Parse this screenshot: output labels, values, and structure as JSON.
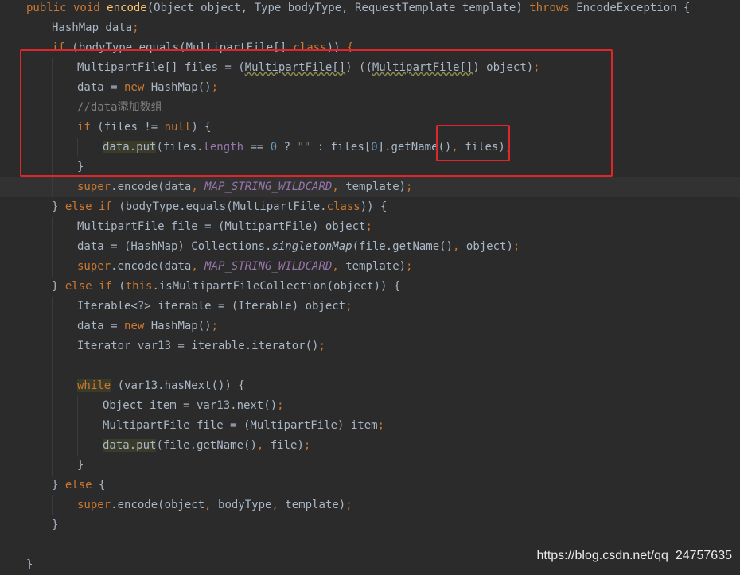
{
  "editor": {
    "lines": [
      {
        "tokens": [
          [
            "kw",
            "public void "
          ],
          [
            "fn",
            "encode"
          ],
          [
            "",
            "(Object object, Type bodyType, RequestTemplate template) "
          ],
          [
            "kw",
            "throws "
          ],
          [
            "",
            "EncodeException {"
          ]
        ]
      },
      {
        "tokens": [
          [
            "",
            "HashMap data"
          ],
          [
            "kw",
            ";"
          ]
        ]
      },
      {
        "tokens": [
          [
            "kw",
            "if "
          ],
          [
            "",
            "(bodyType.equals(MultipartFile[]."
          ],
          [
            "kw",
            "class"
          ],
          [
            "",
            "))"
          ],
          [
            "kw",
            " {"
          ]
        ]
      },
      {
        "tokens": [
          [
            "",
            "MultipartFile[] files = ("
          ],
          [
            "warn",
            "MultipartFile[]"
          ],
          [
            "",
            ") (("
          ],
          [
            "warn",
            "MultipartFile[]"
          ],
          [
            "",
            ") object)"
          ],
          [
            "kw",
            ";"
          ]
        ]
      },
      {
        "tokens": [
          [
            "",
            "data = "
          ],
          [
            "kw",
            "new "
          ],
          [
            "",
            "HashMap()"
          ],
          [
            "kw",
            ";"
          ]
        ]
      },
      {
        "tokens": [
          [
            "cmt",
            "//data添加数组"
          ]
        ]
      },
      {
        "tokens": [
          [
            "kw",
            "if "
          ],
          [
            "",
            "(files != "
          ],
          [
            "kw",
            "null"
          ],
          [
            "",
            ") {"
          ]
        ]
      },
      {
        "tokens": [
          [
            "hl",
            "data.put"
          ],
          [
            "",
            "(files."
          ],
          [
            "field",
            "length"
          ],
          [
            "",
            " == "
          ],
          [
            "num",
            "0"
          ],
          [
            "",
            " ? "
          ],
          [
            "str",
            "\"\""
          ],
          [
            "",
            " : files["
          ],
          [
            "num",
            "0"
          ],
          [
            "",
            "].getName()"
          ],
          [
            "kw",
            ", "
          ],
          [
            "",
            "files)"
          ],
          [
            "kw",
            ";"
          ]
        ]
      },
      {
        "tokens": [
          [
            "",
            "}"
          ]
        ]
      },
      {
        "tokens": [
          [
            "kw",
            "super"
          ],
          [
            "",
            ".encode(data"
          ],
          [
            "kw",
            ", "
          ],
          [
            "const",
            "MAP_STRING_WILDCARD"
          ],
          [
            "kw",
            ", "
          ],
          [
            "",
            "template)"
          ],
          [
            "kw",
            ";"
          ]
        ]
      },
      {
        "tokens": [
          [
            "",
            "} "
          ],
          [
            "kw",
            "else if "
          ],
          [
            "",
            "(bodyType.equals(MultipartFile."
          ],
          [
            "kw",
            "class"
          ],
          [
            "",
            ")) {"
          ]
        ]
      },
      {
        "tokens": [
          [
            "",
            "MultipartFile file = (MultipartFile) object"
          ],
          [
            "kw",
            ";"
          ]
        ]
      },
      {
        "tokens": [
          [
            "",
            "data = (HashMap) Collections."
          ],
          [
            "it",
            "singletonMap"
          ],
          [
            "",
            "(file.getName()"
          ],
          [
            "kw",
            ", "
          ],
          [
            "",
            "object)"
          ],
          [
            "kw",
            ";"
          ]
        ]
      },
      {
        "tokens": [
          [
            "kw",
            "super"
          ],
          [
            "",
            ".encode(data"
          ],
          [
            "kw",
            ", "
          ],
          [
            "const",
            "MAP_STRING_WILDCARD"
          ],
          [
            "kw",
            ", "
          ],
          [
            "",
            "template)"
          ],
          [
            "kw",
            ";"
          ]
        ]
      },
      {
        "tokens": [
          [
            "",
            "} "
          ],
          [
            "kw",
            "else if "
          ],
          [
            "",
            "("
          ],
          [
            "kw",
            "this"
          ],
          [
            "",
            ".isMultipartFileCollection(object)) {"
          ]
        ]
      },
      {
        "tokens": [
          [
            "",
            "Iterable<?> iterable = (Iterable) object"
          ],
          [
            "kw",
            ";"
          ]
        ]
      },
      {
        "tokens": [
          [
            "",
            "data = "
          ],
          [
            "kw",
            "new "
          ],
          [
            "",
            "HashMap()"
          ],
          [
            "kw",
            ";"
          ]
        ]
      },
      {
        "tokens": [
          [
            "",
            "Iterator var13 = iterable.iterator()"
          ],
          [
            "kw",
            ";"
          ]
        ]
      },
      {
        "tokens": []
      },
      {
        "tokens": [
          [
            "kwhl",
            "while"
          ],
          [
            "",
            " (var13.hasNext()) {"
          ]
        ]
      },
      {
        "tokens": [
          [
            "",
            "Object item = var13.next()"
          ],
          [
            "kw",
            ";"
          ]
        ]
      },
      {
        "tokens": [
          [
            "",
            "MultipartFile file = (MultipartFile) item"
          ],
          [
            "kw",
            ";"
          ]
        ]
      },
      {
        "tokens": [
          [
            "hl",
            "data.put"
          ],
          [
            "",
            "(file.getName()"
          ],
          [
            "kw",
            ", "
          ],
          [
            "",
            "file)"
          ],
          [
            "kw",
            ";"
          ]
        ]
      },
      {
        "tokens": [
          [
            "",
            "}"
          ]
        ]
      },
      {
        "tokens": [
          [
            "",
            "} "
          ],
          [
            "kw",
            "else "
          ],
          [
            "",
            "{"
          ]
        ]
      },
      {
        "tokens": [
          [
            "kw",
            "super"
          ],
          [
            "",
            ".encode(object"
          ],
          [
            "kw",
            ", "
          ],
          [
            "",
            "bodyType"
          ],
          [
            "kw",
            ", "
          ],
          [
            "",
            "template)"
          ],
          [
            "kw",
            ";"
          ]
        ]
      },
      {
        "tokens": [
          [
            "",
            "}"
          ]
        ]
      },
      {
        "tokens": []
      },
      {
        "tokens": [
          [
            "",
            "}"
          ]
        ]
      }
    ]
  },
  "colors": {
    "background": "#2b2b2b",
    "keyword": "#cc7832",
    "method": "#ffc66d",
    "number": "#6897bb",
    "string": "#6a8759",
    "comment": "#808080",
    "constant": "#9876aa",
    "annotation_box": "#e0262b"
  },
  "watermark": "https://blog.csdn.net/qq_24757635"
}
